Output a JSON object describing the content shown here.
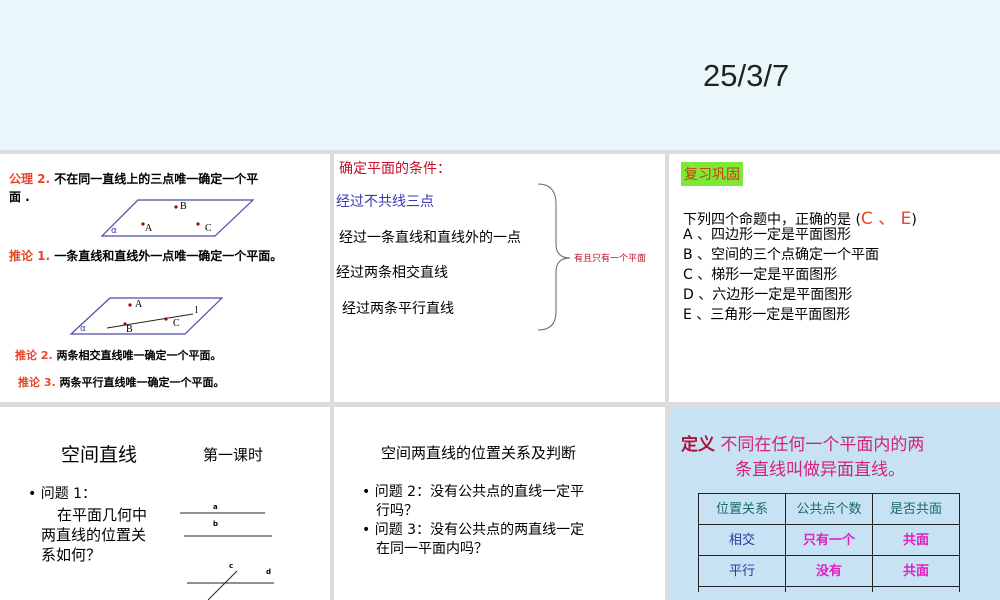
{
  "banner": {
    "date": "25/3/7"
  },
  "p1": {
    "axiom2_label": "公理 2.",
    "axiom2_text": "不在同一直线上的三点唯一确定一个平",
    "axiom2_text2": "面 .",
    "cor1_label": "推论 1.",
    "cor1_text": "一条直线和直线外一点唯一确定一个平面。",
    "cor2_label": "推论 2.",
    "cor2_text": "两条相交直线唯一确定一个平面。",
    "cor3_label": "推论 3.",
    "cor3_text": "两条平行直线唯一确定一个平面。",
    "fig1": {
      "alpha": "α",
      "A": "A",
      "B": "B",
      "C": "C"
    },
    "fig2": {
      "alpha": "α",
      "A": "A",
      "B": "B",
      "C": "C",
      "l": "l"
    }
  },
  "p2": {
    "title": "确定平面的条件：",
    "items": [
      "经过不共线三点",
      "经过一条直线和直线外的一点",
      "经过两条相交直线",
      "经过两条平行直线"
    ],
    "brace_note": "有且只有一个平面"
  },
  "p3": {
    "tag": "复习巩固",
    "question": "下列四个命题中，正确的是 (",
    "answer": "C 、 E",
    "close": ")",
    "options": [
      "A 、四边形一定是平面图形",
      "B 、空间的三个点确定一个平面",
      "C 、梯形一定是平面图形",
      "D 、六边形一定是平面图形",
      "E 、三角形一定是平面图形"
    ]
  },
  "p4": {
    "title": "空间直线",
    "subtitle": "第一课时",
    "q1_label": "问题 1：",
    "q1_text": [
      "在平面几何中",
      "两直线的位置关",
      "系如何？"
    ],
    "lines": {
      "a": "a",
      "b": "b",
      "c": "c",
      "d": "d"
    }
  },
  "p5": {
    "title": "空间两直线的位置关系及判断",
    "q2": [
      "问题 2：没有公共点的直线一定平",
      "行吗？"
    ],
    "q3": [
      "问题 3：没有公共点的两直线一定",
      "在同一平面内吗？"
    ]
  },
  "p6": {
    "def_label": "定义",
    "def_line1": "不同在任何一个平面内的两",
    "def_line2": "条直线叫做异面直线。",
    "headers": [
      "位置关系",
      "公共点个数",
      "是否共面"
    ],
    "rows": [
      [
        "相交",
        "只有一个",
        "共面"
      ],
      [
        "平行",
        "没有",
        "共面"
      ]
    ]
  }
}
